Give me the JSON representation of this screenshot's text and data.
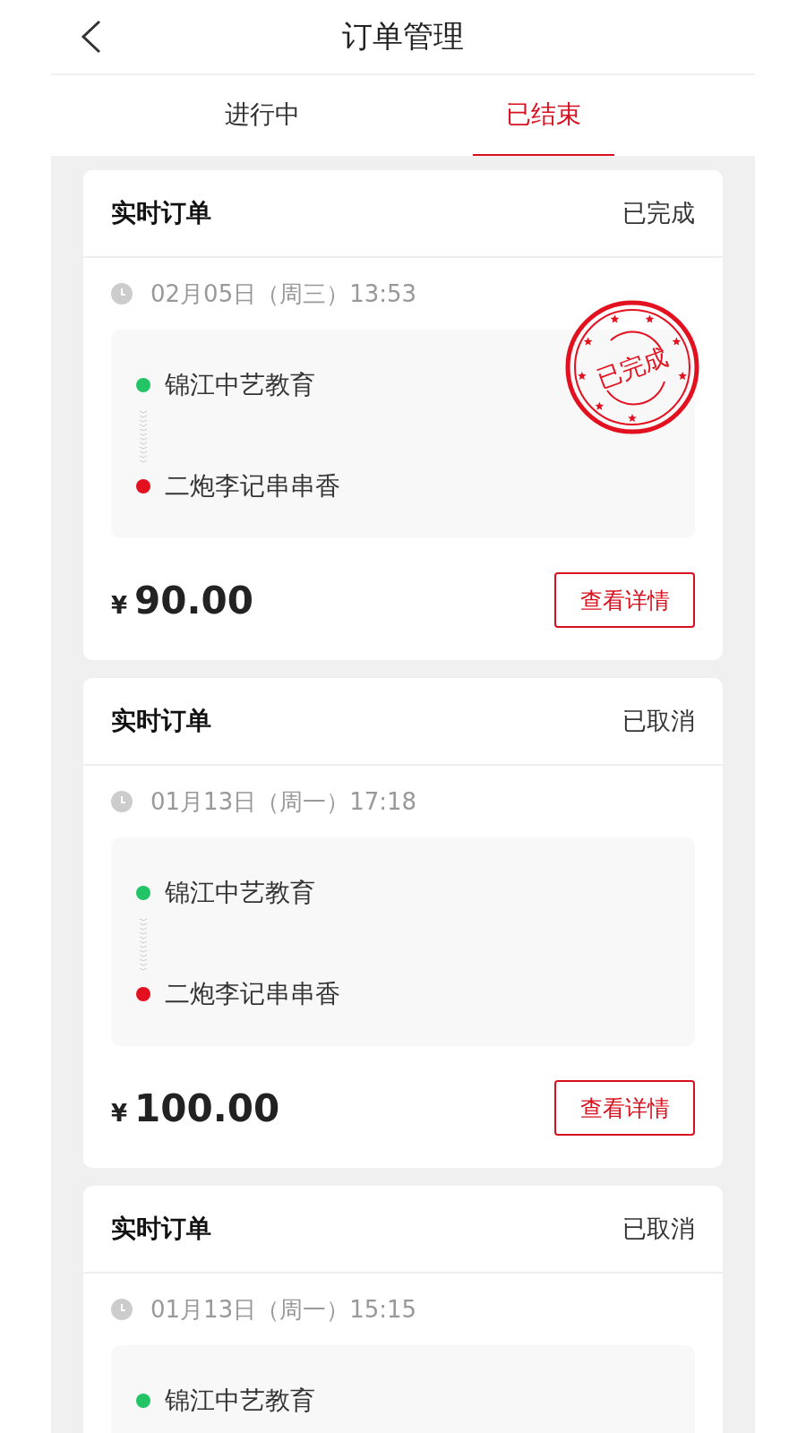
{
  "header": {
    "title": "订单管理"
  },
  "tabs": [
    {
      "label": "进行中",
      "selected": false
    },
    {
      "label": "已结束",
      "selected": true
    }
  ],
  "orders": [
    {
      "type": "实时订单",
      "status": "已完成",
      "stamp": "已完成",
      "time": "02月05日（周三）13:53",
      "stops": [
        {
          "name": "锦江中艺教育",
          "color": "#22c466"
        },
        {
          "name": "二炮李记串串香",
          "color": "#e3101f"
        }
      ],
      "currency": "¥",
      "amount": "90.00",
      "action": "查看详情"
    },
    {
      "type": "实时订单",
      "status": "已取消",
      "time": "01月13日（周一）17:18",
      "stops": [
        {
          "name": "锦江中艺教育",
          "color": "#22c466"
        },
        {
          "name": "二炮李记串串香",
          "color": "#e3101f"
        }
      ],
      "currency": "¥",
      "amount": "100.00",
      "action": "查看详情"
    },
    {
      "type": "实时订单",
      "status": "已取消",
      "time": "01月13日（周一）15:15",
      "stops": [
        {
          "name": "锦江中艺教育",
          "color": "#22c466"
        }
      ]
    }
  ]
}
